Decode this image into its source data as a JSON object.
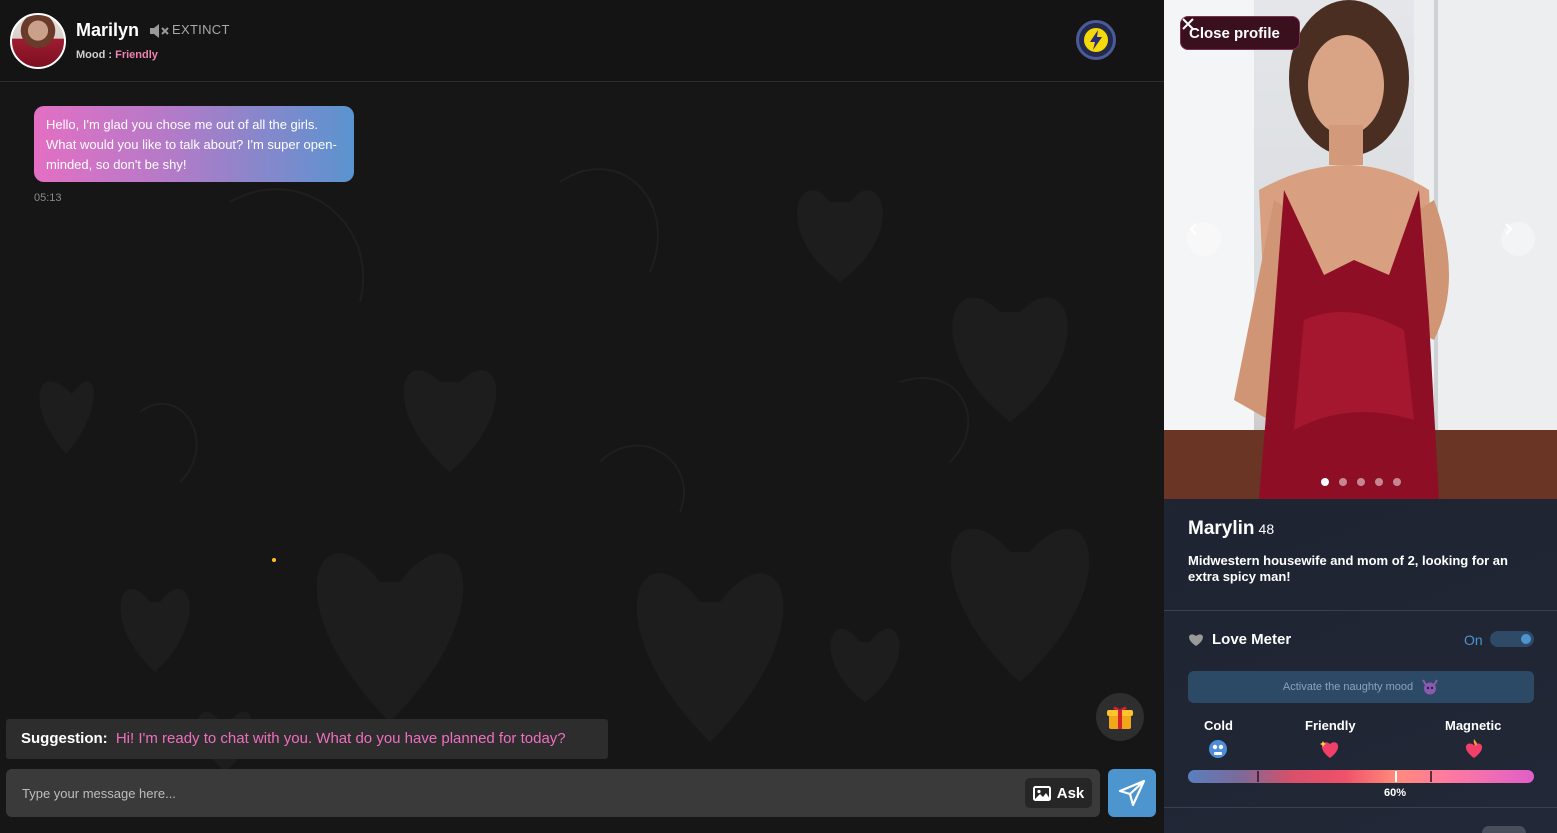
{
  "header": {
    "name": "Marilyn",
    "status": "EXTINCT",
    "mood_label": "Mood :",
    "mood_value": "Friendly"
  },
  "messages": [
    {
      "text": "Hello, I'm glad you chose me out of all the girls. What would you like to talk about? I'm super open-minded, so don't be shy!",
      "time": "05:13"
    }
  ],
  "suggestion": {
    "label": "Suggestion:",
    "text": "Hi! I'm ready to chat with you. What do you have planned for today?"
  },
  "composer": {
    "placeholder": "Type your message here...",
    "ask_label": "Ask"
  },
  "profile": {
    "close_label": "Close profile",
    "name": "Marylin",
    "age": "48",
    "bio": "Midwestern housewife and mom of 2, looking for an extra spicy man!",
    "photo_count": 5,
    "active_photo": 1
  },
  "love_meter": {
    "title": "Love Meter",
    "state": "On",
    "naughty_button": "Activate the naughty mood",
    "levels": [
      "Cold",
      "Friendly",
      "Magnetic"
    ],
    "value": "60%",
    "value_fraction": 0.6
  },
  "colors": {
    "accent_pink": "#ee6fbf",
    "accent_blue": "#4c95cf",
    "background": "#161616"
  },
  "icons": [
    "mute-icon",
    "bolt-icon",
    "gift-icon",
    "image-icon",
    "send-icon",
    "close-icon",
    "heart-icon",
    "devil-icon"
  ]
}
